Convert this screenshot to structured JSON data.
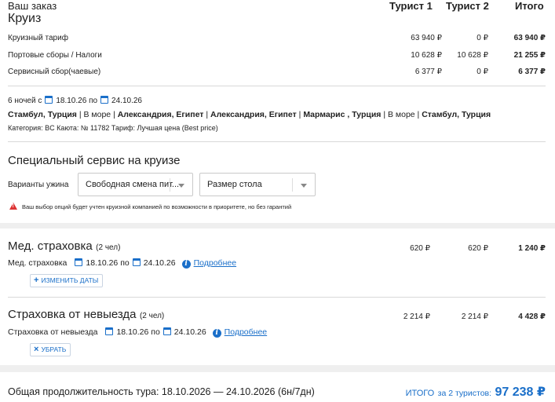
{
  "order": {
    "heading": "Ваш заказ",
    "section": "Круиз",
    "columns": [
      "Турист 1",
      "Турист 2",
      "Итого"
    ],
    "rows": [
      {
        "label": "Круизный тариф",
        "t1": "63 940 ₽",
        "t2": "0 ₽",
        "total": "63 940 ₽"
      },
      {
        "label": "Портовые сборы / Налоги",
        "t1": "10 628 ₽",
        "t2": "10 628 ₽",
        "total": "21 255 ₽"
      },
      {
        "label": "Сервисный сбор(чаевые)",
        "t1": "6 377 ₽",
        "t2": "0 ₽",
        "total": "6 377 ₽"
      }
    ]
  },
  "cruise": {
    "nights_prefix": "6 ночей с",
    "date_from": "18.10.26",
    "to_word": "по",
    "date_to": "24.10.26",
    "route": [
      {
        "text": "Стамбул, Турция",
        "bold": true
      },
      {
        "text": " | ",
        "bold": false
      },
      {
        "text": "В море",
        "bold": false
      },
      {
        "text": " | ",
        "bold": false
      },
      {
        "text": "Александрия, Египет",
        "bold": true
      },
      {
        "text": " | ",
        "bold": false
      },
      {
        "text": "Александрия, Египет",
        "bold": true
      },
      {
        "text": " | ",
        "bold": false
      },
      {
        "text": "Мармарис , Турция",
        "bold": true
      },
      {
        "text": " | ",
        "bold": false
      },
      {
        "text": "В море",
        "bold": false
      },
      {
        "text": " | ",
        "bold": false
      },
      {
        "text": "Стамбул, Турция",
        "bold": true
      }
    ],
    "details": "Категория: BC  Каюта: № 11782  Тариф: Лучшая цена (Best price)"
  },
  "special": {
    "title": "Специальный сервис на круизе",
    "dinner_label": "Варианты ужина",
    "dinner_value": "Свободная смена пит...",
    "table_value": "Размер стола",
    "warning": "Ваш выбор опций будет учтен круизной компанией по возможности в приоритете, но без гарантий"
  },
  "med": {
    "title": "Мед. страховка",
    "count": "(2 чел)",
    "t1": "620 ₽",
    "t2": "620 ₽",
    "total": "1 240 ₽",
    "sub_label": "Мед. страховка",
    "date_from": "18.10.26",
    "to_word": "по",
    "date_to": "24.10.26",
    "more": "Подробнее",
    "button": "ИЗМЕНИТЬ ДАТЫ"
  },
  "cancel": {
    "title": "Страховка от невыезда",
    "count": "(2 чел)",
    "t1": "2 214 ₽",
    "t2": "2 214 ₽",
    "total": "4 428 ₽",
    "sub_label": "Страховка от невыезда",
    "date_from": "18.10.26",
    "to_word": "по",
    "date_to": "24.10.26",
    "more": "Подробнее",
    "button": "УБРАТЬ"
  },
  "footer": {
    "duration": "Общая продолжительность тура: 18.10.2026 — 24.10.2026 (6н/7дн)",
    "total_label": "ИТОГО",
    "total_for": "за 2 туристов:",
    "total_value": "97 238 ₽"
  },
  "colors": {
    "accent": "#1a6fc9",
    "warning": "#dd3333"
  }
}
